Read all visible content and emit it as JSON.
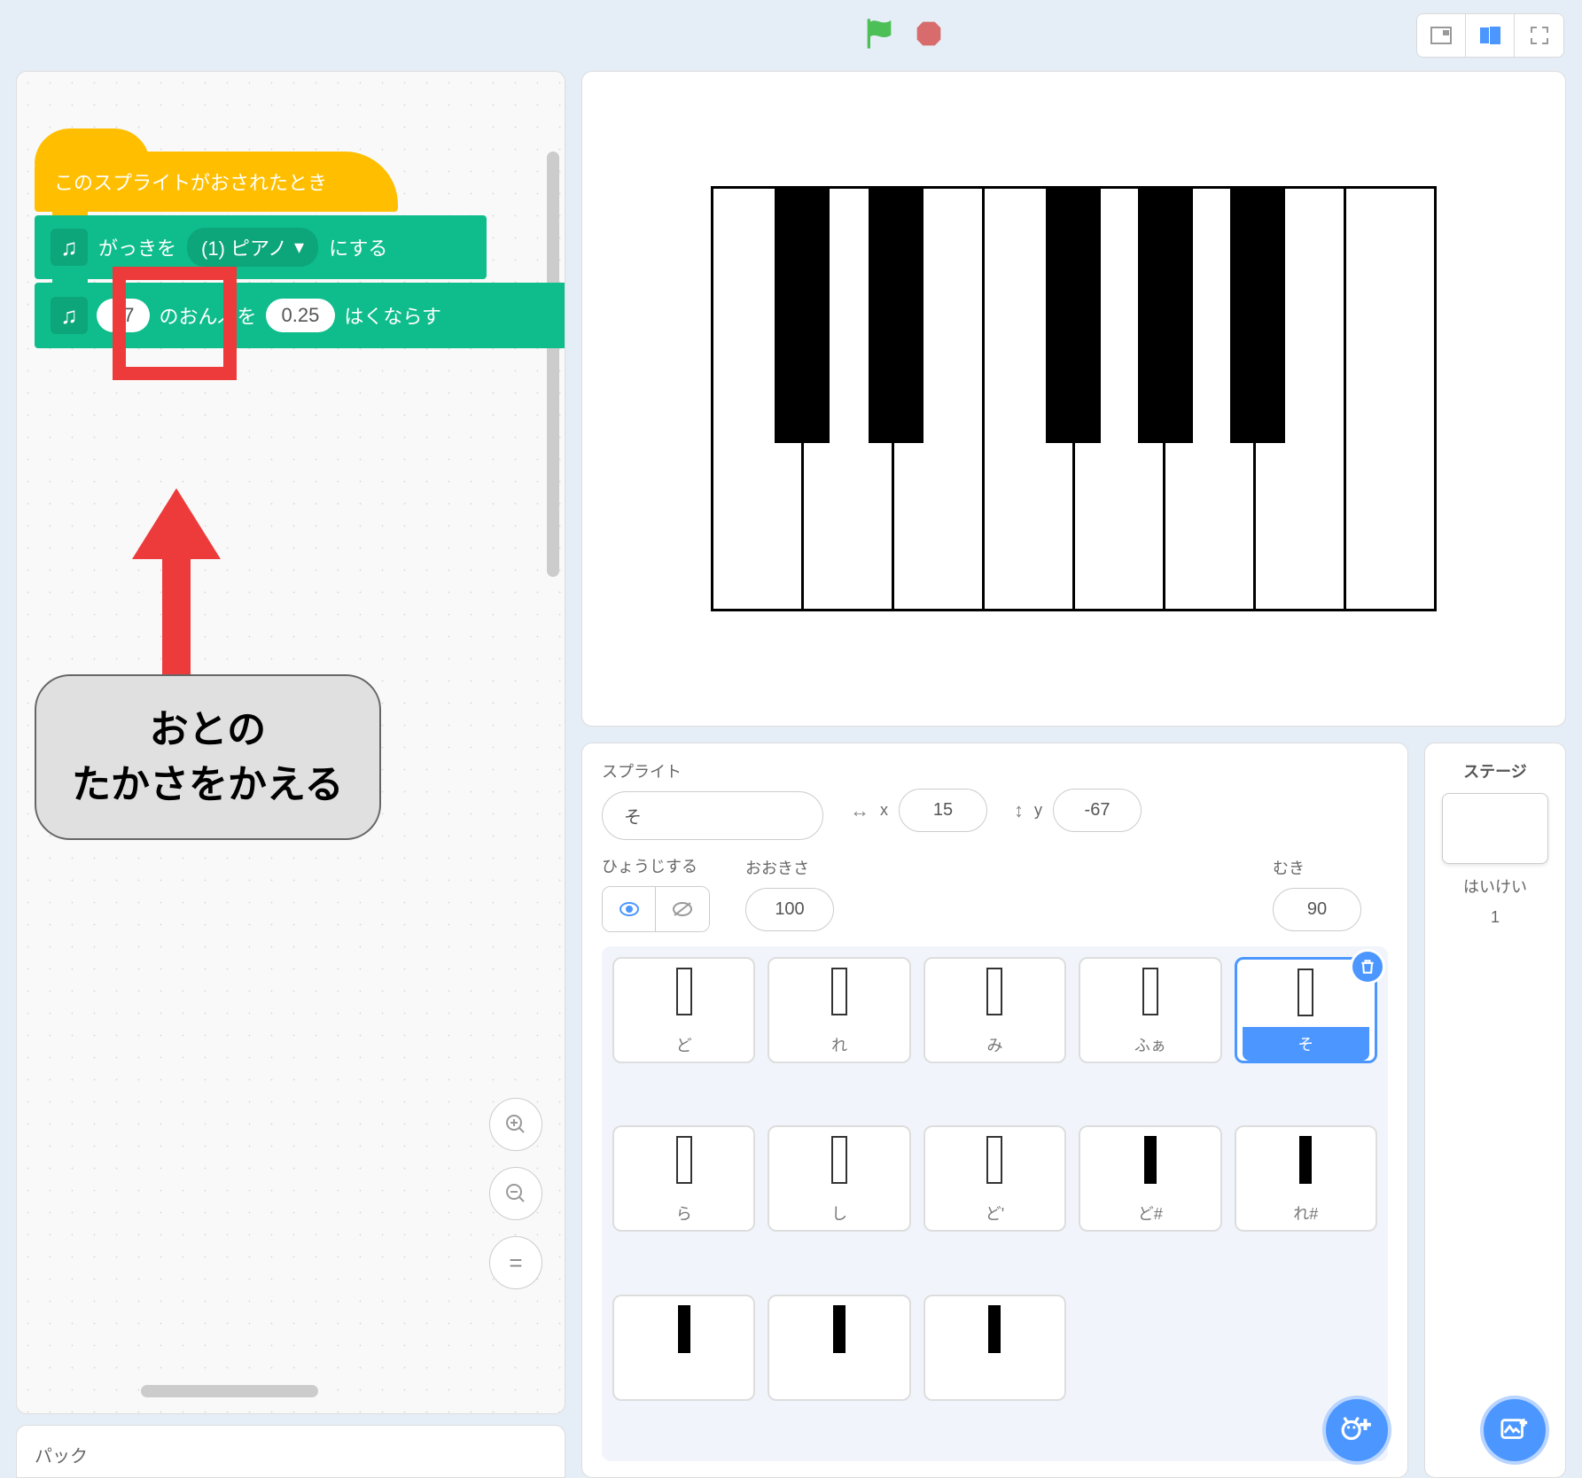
{
  "blocks": {
    "hat_label": "このスプライトがおされたとき",
    "set_instrument_pre": "がっきを",
    "instrument_value": "(1) ピアノ",
    "set_instrument_post": "にする",
    "note_value": "67",
    "note_mid": "のおんぷを",
    "beats_value": "0.25",
    "note_post": "はくならす"
  },
  "callout": {
    "line1": "おとの",
    "line2": "たかさをかえる"
  },
  "zoom": {
    "in": "⊕",
    "out": "⊖",
    "reset": "="
  },
  "backpack_label": "パック",
  "sprite_panel": {
    "sprite_label": "スプライト",
    "name_value": "そ",
    "x_label": "x",
    "x_value": "15",
    "y_label": "y",
    "y_value": "-67",
    "show_label": "ひょうじする",
    "size_label": "おおきさ",
    "size_value": "100",
    "direction_label": "むき",
    "direction_value": "90"
  },
  "sprites": [
    {
      "name": "ど",
      "black": false
    },
    {
      "name": "れ",
      "black": false
    },
    {
      "name": "み",
      "black": false
    },
    {
      "name": "ふぁ",
      "black": false
    },
    {
      "name": "そ",
      "black": false,
      "selected": true
    },
    {
      "name": "ら",
      "black": false
    },
    {
      "name": "し",
      "black": false
    },
    {
      "name": "ど'",
      "black": false
    },
    {
      "name": "ど#",
      "black": true
    },
    {
      "name": "れ#",
      "black": true
    },
    {
      "name": "",
      "black": true
    },
    {
      "name": "",
      "black": true
    },
    {
      "name": "",
      "black": true
    }
  ],
  "stage_panel": {
    "title": "ステージ",
    "backdrop_label": "はいけい",
    "backdrop_count": "1"
  }
}
